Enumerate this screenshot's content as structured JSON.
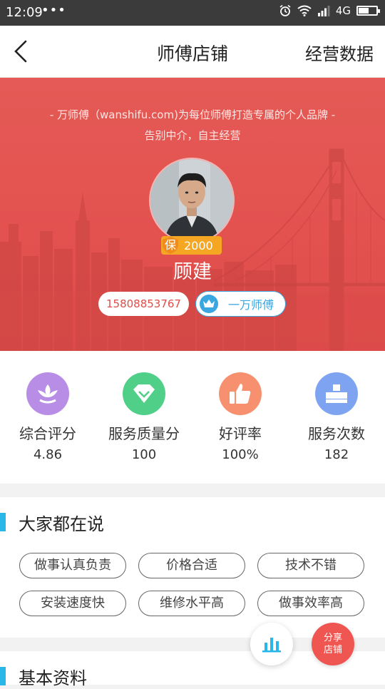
{
  "status_bar": {
    "time": "12:09",
    "dots": "•••",
    "network": "4G"
  },
  "nav": {
    "title": "师傅店铺",
    "right_label": "经营数据"
  },
  "banner": {
    "slogan_line1": "- 万师傅（wanshifu.com)为每位师傅打造专属的个人品牌 -",
    "slogan_line2": "告别中介，自主经营",
    "badge_char": "保",
    "badge_amount": "2000",
    "name": "顾建",
    "phone": "15808853767",
    "brand": "一万师傅"
  },
  "stats": [
    {
      "label": "综合评分",
      "value": "4.86",
      "icon": "lotus-icon",
      "color": "#b88de6"
    },
    {
      "label": "服务质量分",
      "value": "100",
      "icon": "diamond-icon",
      "color": "#4fcf87"
    },
    {
      "label": "好评率",
      "value": "100%",
      "icon": "thumbs-up-icon",
      "color": "#f7906e"
    },
    {
      "label": "服务次数",
      "value": "182",
      "icon": "blocks-icon",
      "color": "#7ea3f0"
    }
  ],
  "reviews": {
    "title": "大家都在说",
    "tags": [
      "做事认真负责",
      "价格合适",
      "技术不错",
      "安装速度快",
      "维修水平高",
      "做事效率高"
    ]
  },
  "basic_info": {
    "title": "基本资料"
  },
  "fab": {
    "share_line1": "分享",
    "share_line2": "店铺"
  },
  "colors": {
    "accent": "#29b6e8",
    "banner_red": "#e3524f",
    "badge_orange": "#f5a623"
  }
}
